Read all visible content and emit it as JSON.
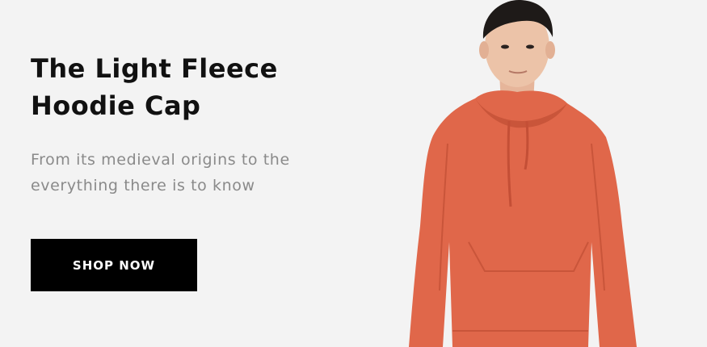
{
  "hero": {
    "title_line1": "The Light Fleece",
    "title_line2": "Hoodie Cap",
    "subtitle": "From its medieval origins to the everything there is to know",
    "cta_label": "SHOP NOW"
  },
  "colors": {
    "background": "#f3f3f3",
    "hoodie": "#e0674a",
    "button": "#000000",
    "title": "#111111",
    "subtitle": "#8a8a8a"
  }
}
